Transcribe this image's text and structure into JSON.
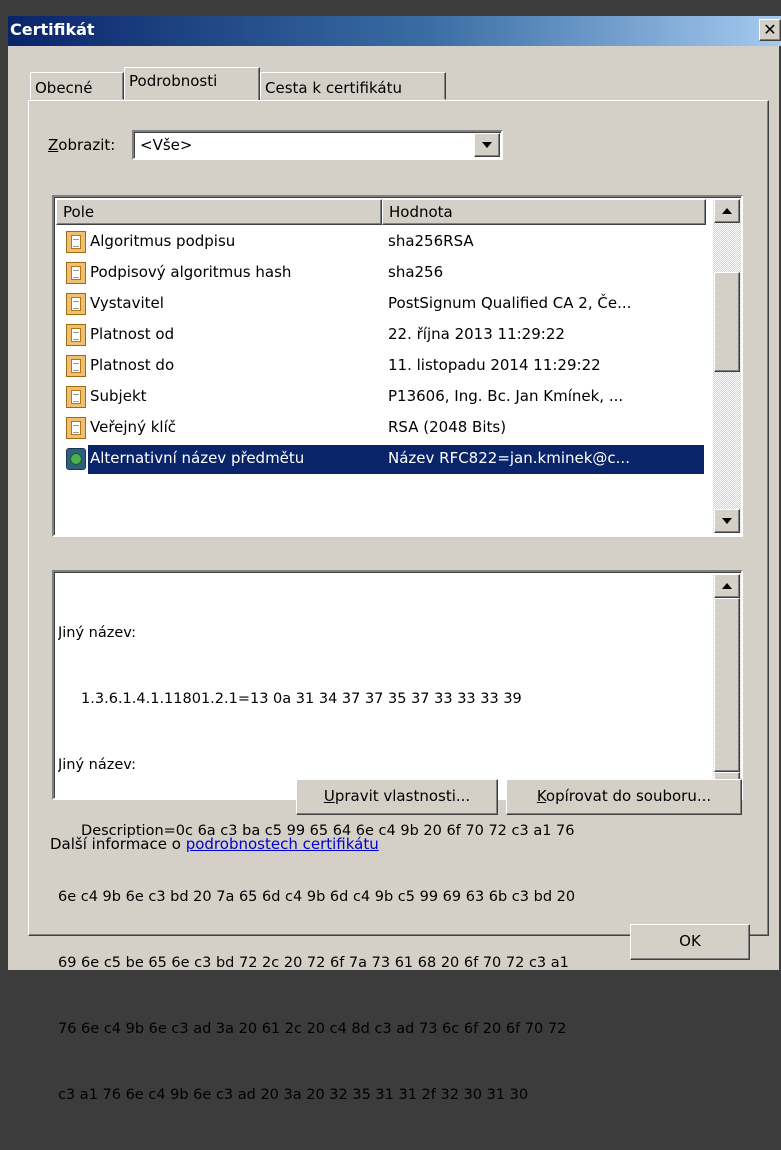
{
  "window": {
    "title": "Certifikát",
    "close_glyph": "✕"
  },
  "tabs": [
    {
      "label": "Obecné"
    },
    {
      "label": "Podrobnosti"
    },
    {
      "label": "Cesta k certifikátu"
    }
  ],
  "show": {
    "label_mnemonic": "Z",
    "label_rest": "obrazit:",
    "selected": "<Vše>"
  },
  "fields_list": {
    "columns": {
      "field": "Pole",
      "value": "Hodnota"
    },
    "rows": [
      {
        "name": "Algoritmus podpisu",
        "value": "sha256RSA"
      },
      {
        "name": "Podpisový algoritmus hash",
        "value": "sha256"
      },
      {
        "name": "Vystavitel",
        "value": "PostSignum Qualified CA 2, Če..."
      },
      {
        "name": "Platnost od",
        "value": "22. října 2013 11:29:22"
      },
      {
        "name": "Platnost do",
        "value": "11. listopadu 2014 11:29:22"
      },
      {
        "name": "Subjekt",
        "value": "P13606, Ing. Bc. Jan Kmínek, ..."
      },
      {
        "name": "Veřejný klíč",
        "value": "RSA (2048 Bits)"
      },
      {
        "name": "Alternativní název předmětu",
        "value": "Název RFC822=jan.kminek@c..."
      }
    ],
    "selected_index": 7
  },
  "detail": {
    "lines": [
      "Jiný název:",
      "     1.3.6.1.4.1.11801.2.1=13 0a 31 34 37 37 35 37 33 33 33 39",
      "Jiný název:",
      "     Description=0c 6a c3 ba c5 99 65 64 6e c4 9b 20 6f 70 72 c3 a1 76",
      "6e c4 9b 6e c3 bd 20 7a 65 6d c4 9b 6d c4 9b c5 99 69 63 6b c3 bd 20",
      "69 6e c5 be 65 6e c3 bd 72 2c 20 72 6f 7a 73 61 68 20 6f 70 72 c3 a1",
      "76 6e c4 9b 6e c3 ad 3a 20 61 2c 20 c4 8d c3 ad 73 6c 6f 20 6f 70 72",
      "c3 a1 76 6e c4 9b 6e c3 ad 20 3a 20 32 35 31 31 2f 32 30 31 30"
    ]
  },
  "buttons": {
    "edit_mnemonic": "U",
    "edit_rest": "pravit vlastnosti...",
    "copy_mnemonic": "K",
    "copy_rest": "opírovat do souboru...",
    "ok": "OK"
  },
  "more_info": {
    "prefix": "Další informace o ",
    "link": "podrobnostech certifikátu"
  }
}
